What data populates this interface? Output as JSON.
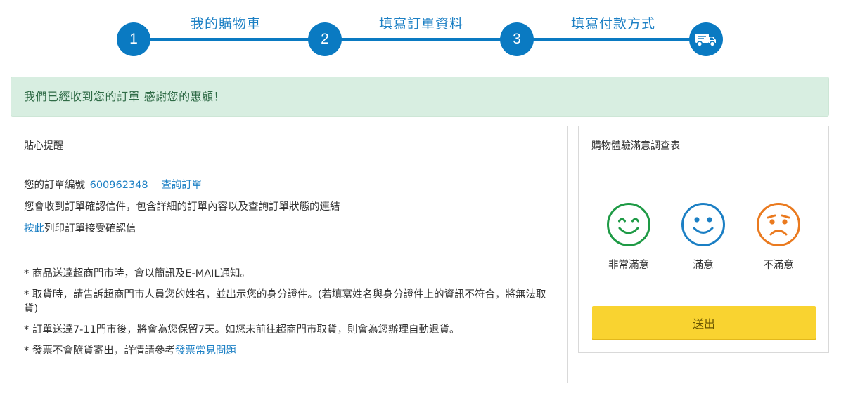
{
  "steps": [
    {
      "number": "1",
      "label": "我的購物車"
    },
    {
      "number": "2",
      "label": "填寫訂單資料"
    },
    {
      "number": "3",
      "label": "填寫付款方式"
    }
  ],
  "final_step_icon": "truck-icon",
  "alert": {
    "text": "我們已經收到您的訂單 感謝您的惠顧！",
    "color": "#d8eee1"
  },
  "notice": {
    "title": "貼心提醒",
    "order_label": "您的訂單編號",
    "order_number": "600962348",
    "query_link": "查詢訂單",
    "email_text": "您會收到訂單確認信件，包含詳細的訂單內容以及查詢訂單狀態的連結",
    "print_link": "按此",
    "print_text": "列印訂單接受確認信",
    "notes": [
      "* 商品送達超商門市時，會以簡訊及E-MAIL通知。",
      "* 取貨時，請告訴超商門市人員您的姓名，並出示您的身分證件。(若填寫姓名與身分證件上的資訊不符合，將無法取貨)",
      "* 訂單送達7-11門市後，將會為您保留7天。如您未前往超商門市取貨，則會為您辦理自動退貨。"
    ],
    "invoice_text": "* 發票不會隨貨寄出，詳情請參考",
    "invoice_link": "發票常見問題"
  },
  "survey": {
    "title": "購物體驗滿意調查表",
    "options": [
      {
        "label": "非常滿意",
        "icon": "very-happy-face-icon",
        "color": "#1e9a45"
      },
      {
        "label": "滿意",
        "icon": "smile-face-icon",
        "color": "#1b7fc4"
      },
      {
        "label": "不滿意",
        "icon": "sad-face-icon",
        "color": "#ea7a1f"
      }
    ],
    "submit_label": "送出",
    "submit_color": "#f9d330"
  },
  "accent_color": "#0a7ac2"
}
